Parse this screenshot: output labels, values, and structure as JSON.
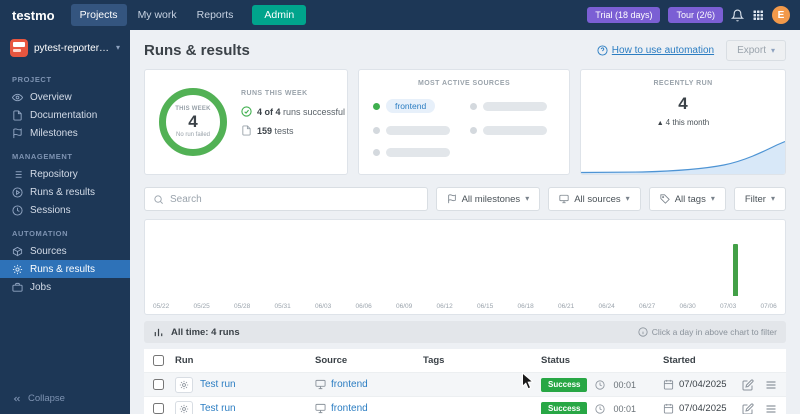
{
  "colors": {
    "navy": "#1d3756",
    "active_blue": "#2e72b8",
    "admin_teal": "#00a48c",
    "badge_purple": "#7b5fd4",
    "avatar_orange": "#f2994a",
    "link_blue": "#2b7dc2",
    "success_green": "#28a745",
    "ring_green": "#52b155",
    "bar_green": "#43a047"
  },
  "navbar": {
    "brand": "testmo",
    "items": [
      {
        "label": "Projects"
      },
      {
        "label": "My work"
      },
      {
        "label": "Reports"
      }
    ],
    "admin": "Admin",
    "trial": "Trial (18 days)",
    "tour": "Tour (2/6)",
    "avatar": "E"
  },
  "sidebar": {
    "project": "pytest-reporter-...",
    "sections": [
      {
        "title": "PROJECT",
        "items": [
          {
            "label": "Overview"
          },
          {
            "label": "Documentation"
          },
          {
            "label": "Milestones"
          }
        ]
      },
      {
        "title": "MANAGEMENT",
        "items": [
          {
            "label": "Repository"
          },
          {
            "label": "Runs & results"
          },
          {
            "label": "Sessions"
          }
        ]
      },
      {
        "title": "AUTOMATION",
        "items": [
          {
            "label": "Sources"
          },
          {
            "label": "Runs & results"
          },
          {
            "label": "Jobs"
          }
        ]
      }
    ],
    "collapse": "Collapse"
  },
  "header": {
    "title": "Runs & results",
    "help": "How to use automation",
    "export": "Export"
  },
  "cards": {
    "week": {
      "ring_top": "THIS WEEK",
      "ring_value": "4",
      "ring_sub": "No run failed",
      "runs_title": "RUNS THIS WEEK",
      "line1_strong": "4 of 4",
      "line1_rest": " runs successful",
      "line2_strong": "159",
      "line2_rest": " tests"
    },
    "sources": {
      "title": "MOST ACTIVE SOURCES",
      "active": "frontend"
    },
    "recent": {
      "title": "RECENTLY RUN",
      "value": "4",
      "trend": "4 this month"
    }
  },
  "filters": {
    "search_placeholder": "Search",
    "milestones": "All milestones",
    "sources": "All sources",
    "tags": "All tags",
    "filter": "Filter"
  },
  "chart_data": {
    "type": "bar",
    "title": "Runs per day timeline",
    "x_ticks": [
      "05/22",
      "05/25",
      "05/28",
      "05/31",
      "06/03",
      "06/06",
      "06/09",
      "06/12",
      "06/15",
      "06/18",
      "06/21",
      "06/24",
      "06/27",
      "06/30",
      "07/03",
      "07/06"
    ],
    "series": [
      {
        "name": "runs",
        "points": [
          {
            "x": "07/03",
            "y": 4
          }
        ]
      }
    ],
    "y_max": 4,
    "bar_color": "#43a047"
  },
  "summary": {
    "label": "All time: 4 runs",
    "hint": "Click a day in above chart to filter"
  },
  "table": {
    "columns": {
      "run": "Run",
      "source": "Source",
      "tags": "Tags",
      "status": "Status",
      "started": "Started"
    },
    "rows": [
      {
        "run": "Test run",
        "source": "frontend",
        "tags": "",
        "status": "Success",
        "duration": "00:01",
        "started": "07/04/2025"
      },
      {
        "run": "Test run",
        "source": "frontend",
        "tags": "",
        "status": "Success",
        "duration": "00:01",
        "started": "07/04/2025"
      }
    ]
  }
}
